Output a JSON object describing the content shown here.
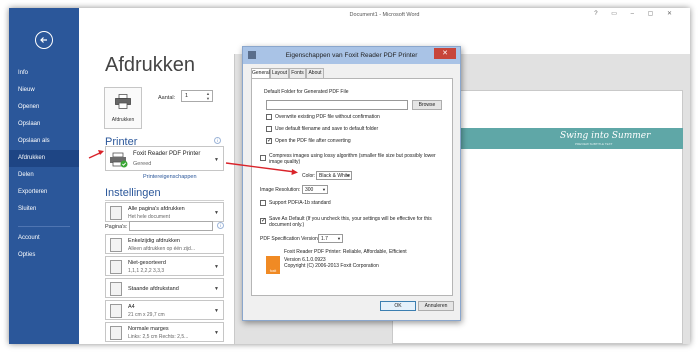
{
  "window": {
    "title": "Document1 - Microsoft Word"
  },
  "sidebar": {
    "items": [
      {
        "label": "Info"
      },
      {
        "label": "Nieuw"
      },
      {
        "label": "Openen"
      },
      {
        "label": "Opslaan"
      },
      {
        "label": "Opslaan als"
      },
      {
        "label": "Afdrukken"
      },
      {
        "label": "Delen"
      },
      {
        "label": "Exporteren"
      },
      {
        "label": "Sluiten"
      },
      {
        "label": "Account"
      },
      {
        "label": "Opties"
      }
    ],
    "active": "Afdrukken"
  },
  "print": {
    "title": "Afdrukken",
    "print_button": "Afdrukken",
    "copies_label": "Aantal:",
    "copies_value": "1",
    "printer_section": "Printer",
    "printer_name": "Foxit Reader PDF Printer",
    "printer_status": "Gereed",
    "printer_properties_link": "Printereigenschappen",
    "settings_section": "Instellingen",
    "settings": [
      {
        "line1": "Alle pagina's afdrukken",
        "line2": "Het hele document"
      },
      {
        "line1": "Enkelzijdig afdrukken",
        "line2": "Alleen afdrukken op één zijd..."
      },
      {
        "line1": "Niet-gesorteerd",
        "line2": "1,1,1   2,2,2   3,3,3"
      },
      {
        "line1": "Staande afdrukstand",
        "line2": ""
      },
      {
        "line1": "A4",
        "line2": "21 cm x 29,7 cm"
      },
      {
        "line1": "Normale marges",
        "line2": "Links: 2,5 cm   Rechts: 2,5..."
      }
    ],
    "pages_label": "Pagina's:",
    "info_icon": "info-icon"
  },
  "preview": {
    "banner_title": "Swing into Summer",
    "banner_subtitle": "PREVIEW SUBTITLE TEXT",
    "banner_color": "#5fa7a7"
  },
  "dialog": {
    "title": "Eigenschappen van Foxit Reader PDF Printer",
    "tabs": [
      {
        "label": "General"
      },
      {
        "label": "Layout"
      },
      {
        "label": "Fonts"
      },
      {
        "label": "About"
      }
    ],
    "default_folder_label": "Default Folder for Generated PDF File",
    "browse_button": "Browse",
    "overwrite_label": "Overwrite existing PDF file without confirmation",
    "default_filename_label": "Use default filename and save to default folder",
    "open_pdf_label": "Open the PDF file after converting",
    "compress_label_1": "Compress images using lossy algorithm (smaller file size but possibly lower",
    "compress_label_2": "image quality)",
    "color_label": "Color:",
    "color_value": "Black & White",
    "resolution_label": "Image Resolution:",
    "resolution_value": "300",
    "pdfa_label": "Support PDF/A-1b standard",
    "save_default_label_1": "Save As Default (If you uncheck this, your settings will be effective for this",
    "save_default_label_2": "document only.)",
    "pdf_version_label": "PDF Specification Version:",
    "pdf_version_value": "1.7",
    "about_line1": "Foxit Reader PDF Printer: Reliable, Affordable, Efficient",
    "about_line2": "Version 6.1.0.0923",
    "about_line3": "Copyright (C) 2006-2013 Foxit Corporation",
    "logo_text": "foxit",
    "ok_button": "OK",
    "cancel_button": "Annuleren",
    "checkboxes": {
      "overwrite": false,
      "default_filename": false,
      "open_pdf": true,
      "compress": false,
      "pdfa": false,
      "save_default": true
    }
  },
  "colors": {
    "sidebar": "#2b579a",
    "active": "#1e4584",
    "annotation_arrow": "#d9232a",
    "dialog_close": "#c7453a"
  }
}
